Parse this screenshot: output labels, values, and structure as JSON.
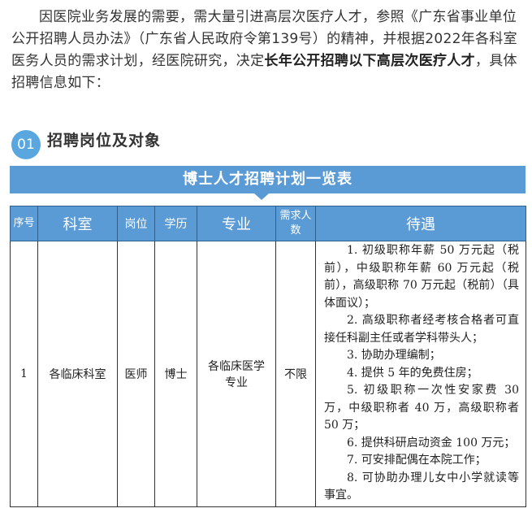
{
  "intro": {
    "text_before": "因医院业务发展的需要，需大量引进高层次医疗人才，参照《广东省事业单位公开招聘人员办法》（广东省人民政府令第139号）的精神，并根据2022年各科室医务人员的需求计划，经医院研究，决定",
    "text_bold": "长年公开招聘以下高层次医疗人才",
    "text_after": "，具体招聘信息如下："
  },
  "section": {
    "number": "01",
    "title": "招聘岗位及对象"
  },
  "banner": {
    "title": "博士人才招聘计划一览表",
    "color": "#5b9bd5"
  },
  "table": {
    "headers": {
      "index": "序号",
      "department": "科室",
      "position": "岗位",
      "education": "学历",
      "major": "专业",
      "quota": "需求人数",
      "benefits": "待遇"
    },
    "row": {
      "index": "1",
      "department": "各临床科室",
      "position": "医师",
      "education": "博士",
      "major": "各临床医学专业",
      "quota": "不限",
      "benefits": [
        "1. 初级职称年薪 50 万元起（税前），中级职称年薪 60 万元起（税前），高级职称 70 万元起（税前）（具体面议）；",
        "2. 高级职称者经考核合格者可直接任科副主任或者学科带头人；",
        "3. 协助办理编制；",
        "4. 提供 5 年的免费住房；",
        "5. 初级职称一次性安家费 30 万，中级职称者 40 万，高级职称者 50 万；",
        "6. 提供科研启动资金 100 万元；",
        "7. 可安排配偶在本院工作；",
        "8. 可协助办理儿女中小学就读等事宜。"
      ]
    }
  }
}
